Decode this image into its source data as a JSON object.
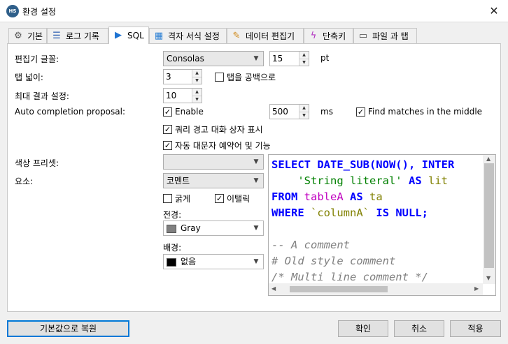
{
  "window": {
    "title": "환경 설정",
    "app_icon_text": "HS",
    "close_label": "✕"
  },
  "tabs": [
    {
      "label": "기본",
      "icon": "gear-icon"
    },
    {
      "label": "로그 기록",
      "icon": "list-icon"
    },
    {
      "label": "SQL",
      "icon": "play-icon"
    },
    {
      "label": "격자 서식 설정",
      "icon": "grid-icon"
    },
    {
      "label": "데이터 편집기",
      "icon": "edit-icon"
    },
    {
      "label": "단축키",
      "icon": "lightning-icon"
    },
    {
      "label": "파일 과 탭",
      "icon": "file-tab-icon"
    }
  ],
  "active_tab": "SQL",
  "settings": {
    "editor_font": {
      "label": "편집기 글꼴:",
      "value": "Consolas",
      "size": "15",
      "unit": "pt"
    },
    "tab_width": {
      "label": "탭 넓이:",
      "value": "3",
      "tabs_as_spaces_label": "탭을 공백으로",
      "tabs_as_spaces_checked": false
    },
    "max_results": {
      "label": "최대 결과 설정:",
      "value": "10"
    },
    "auto_completion": {
      "label": "Auto completion proposal:",
      "enable_label": "Enable",
      "enable_checked": true,
      "delay": "500",
      "delay_unit": "ms",
      "find_matches_label": "Find matches in the middle",
      "find_matches_checked": true
    },
    "show_query_warning": {
      "label": "쿼리 경고 대화 상자 표시",
      "checked": true
    },
    "auto_uppercase": {
      "label": "자동 대문자 예약어 및 기능",
      "checked": true
    },
    "color_preset": {
      "label": "색상 프리셋:",
      "value": ""
    },
    "element": {
      "label": "요소:",
      "value": "코멘트"
    },
    "bold": {
      "label": "굵게",
      "checked": false
    },
    "italic": {
      "label": "이탤릭",
      "checked": true
    },
    "foreground": {
      "label": "전경:",
      "value": "Gray",
      "color": "#808080"
    },
    "background": {
      "label": "배경:",
      "value": "없음",
      "color": "#000000"
    }
  },
  "preview_code": {
    "line1_kw1": "SELECT DATE_SUB(NOW(), INTER",
    "line2_str": "'String literal'",
    "line2_kw": "AS",
    "line2_id": "lit",
    "line3_kw1": "FROM",
    "line3_id1": "tableA",
    "line3_kw2": "AS",
    "line3_id2": "ta",
    "line4_kw1": "WHERE",
    "line4_str": "`columnA`",
    "line4_kw2": "IS NULL;",
    "line6_cm": "-- A comment",
    "line7_cm": "# Old style comment",
    "line8_cm": "/* Multi line comment */"
  },
  "buttons": {
    "reset": "기본값으로 복원",
    "ok": "확인",
    "cancel": "취소",
    "apply": "적용"
  },
  "colors": {
    "accent": "#0078d7",
    "keyword": "#0000ff",
    "string": "#008000",
    "identifier": "#808000",
    "comment": "#808080"
  }
}
